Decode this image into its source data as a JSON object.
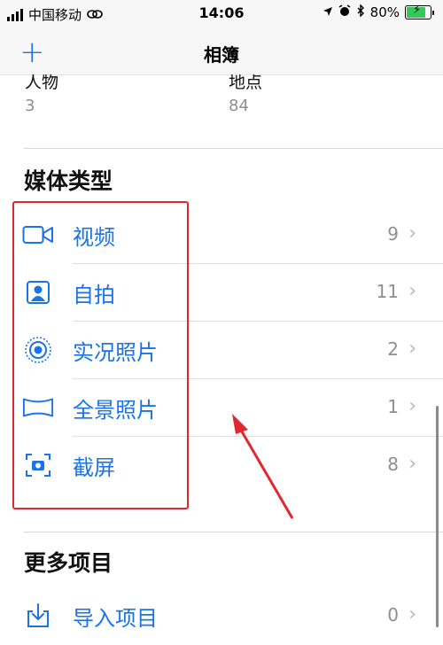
{
  "status_bar": {
    "carrier": "中国移动",
    "time": "14:06",
    "battery_percent": "80%",
    "battery_level": 0.8
  },
  "nav": {
    "add_label": "+",
    "title": "相簿"
  },
  "people_places": [
    {
      "name": "人物",
      "count": "3"
    },
    {
      "name": "地点",
      "count": "84"
    }
  ],
  "media_types": {
    "title": "媒体类型",
    "items": [
      {
        "label": "视频",
        "count": "9",
        "icon": "video-icon"
      },
      {
        "label": "自拍",
        "count": "11",
        "icon": "selfie-icon"
      },
      {
        "label": "实况照片",
        "count": "2",
        "icon": "live-photo-icon"
      },
      {
        "label": "全景照片",
        "count": "1",
        "icon": "panorama-icon"
      },
      {
        "label": "截屏",
        "count": "8",
        "icon": "screenshot-icon"
      }
    ]
  },
  "more_items": {
    "title": "更多项目",
    "items": [
      {
        "label": "导入项目",
        "count": "0",
        "icon": "import-icon"
      }
    ]
  },
  "colors": {
    "accent": "#1a73e8",
    "annotation": "#e0282e",
    "secondary_text": "#8e8e93"
  },
  "chevron": "›"
}
